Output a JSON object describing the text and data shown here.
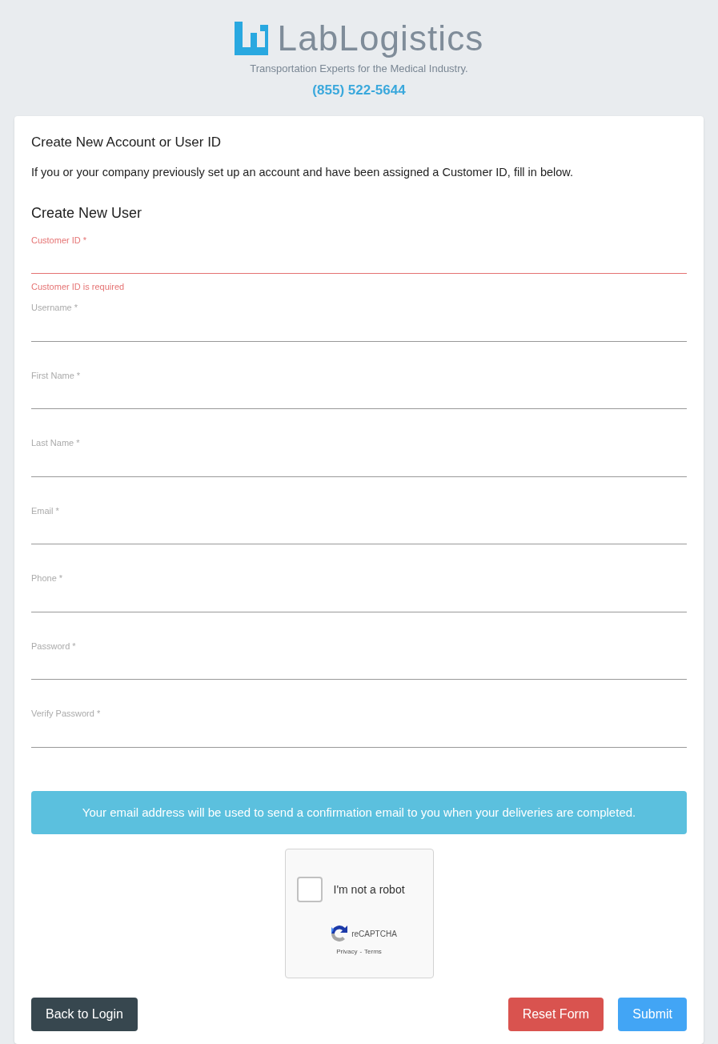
{
  "header": {
    "logo": "LabLogistics",
    "tagline": "Transportation Experts for the Medical Industry.",
    "phone": "(855) 522-5644"
  },
  "card": {
    "title": "Create New Account or User ID",
    "intro": "If you or your company previously set up an account and have been assigned a Customer ID, fill in below.",
    "section": "Create New User"
  },
  "fields": [
    {
      "label": "Customer ID *",
      "error": true,
      "message": "Customer ID is required"
    },
    {
      "label": "Username *",
      "error": false
    },
    {
      "label": "First Name *",
      "error": false
    },
    {
      "label": "Last Name *",
      "error": false
    },
    {
      "label": "Email *",
      "error": false
    },
    {
      "label": "Phone *",
      "error": false
    },
    {
      "label": "Password *",
      "error": false
    },
    {
      "label": "Verify Password *",
      "error": false
    }
  ],
  "notice": "Your email address will be used to send a confirmation email to you when your deliveries are completed.",
  "captcha": {
    "label": "I'm not a robot",
    "checked": false,
    "brand": "reCAPTCHA",
    "privacy": "Privacy",
    "separator": "-",
    "terms": "Terms"
  },
  "buttons": [
    {
      "label": "Back to Login",
      "kind": "secondary"
    },
    {
      "label": "Reset Form",
      "kind": "danger"
    },
    {
      "label": "Submit",
      "kind": "primary"
    }
  ]
}
